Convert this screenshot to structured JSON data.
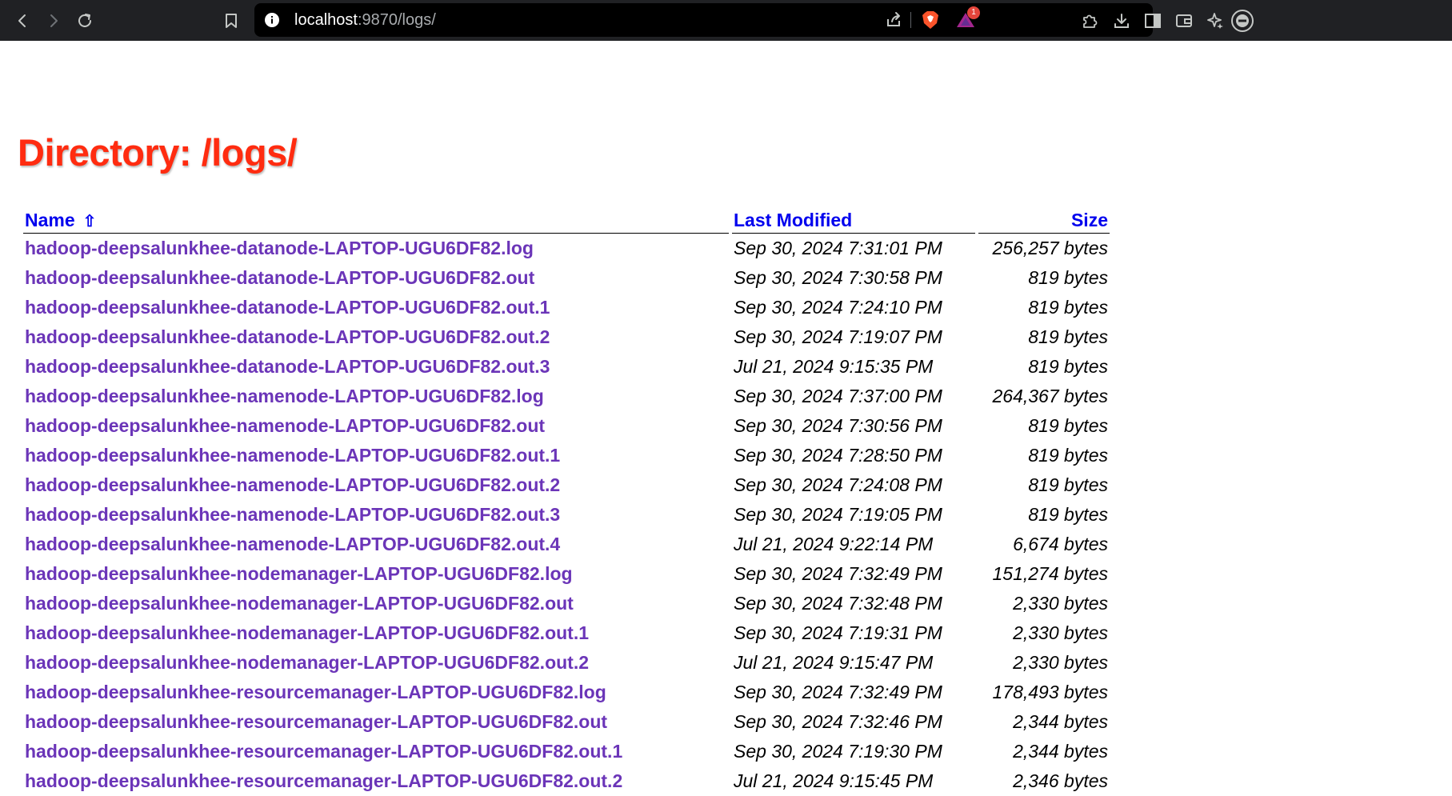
{
  "browser": {
    "url_host": "localhost",
    "url_rest": ":9870/logs/",
    "notification_count": "1",
    "icons": [
      "back-icon",
      "forward-icon",
      "reload-icon",
      "bookmark-icon",
      "site-info-icon",
      "share-icon",
      "brave-shield-icon",
      "brave-rewards-icon",
      "extensions-icon",
      "download-icon",
      "sidebar-icon",
      "wallet-icon",
      "leo-ai-icon",
      "profile-icon"
    ]
  },
  "page": {
    "title": "Directory: /logs/",
    "columns": {
      "name": "Name",
      "sort_indicator": "⇧",
      "modified": "Last Modified",
      "size": "Size"
    },
    "rows": [
      {
        "name": "hadoop-deepsalunkhee-datanode-LAPTOP-UGU6DF82.log",
        "modified": "Sep 30, 2024 7:31:01 PM",
        "size": "256,257 bytes"
      },
      {
        "name": "hadoop-deepsalunkhee-datanode-LAPTOP-UGU6DF82.out",
        "modified": "Sep 30, 2024 7:30:58 PM",
        "size": "819 bytes"
      },
      {
        "name": "hadoop-deepsalunkhee-datanode-LAPTOP-UGU6DF82.out.1",
        "modified": "Sep 30, 2024 7:24:10 PM",
        "size": "819 bytes"
      },
      {
        "name": "hadoop-deepsalunkhee-datanode-LAPTOP-UGU6DF82.out.2",
        "modified": "Sep 30, 2024 7:19:07 PM",
        "size": "819 bytes"
      },
      {
        "name": "hadoop-deepsalunkhee-datanode-LAPTOP-UGU6DF82.out.3",
        "modified": "Jul 21, 2024 9:15:35 PM",
        "size": "819 bytes"
      },
      {
        "name": "hadoop-deepsalunkhee-namenode-LAPTOP-UGU6DF82.log",
        "modified": "Sep 30, 2024 7:37:00 PM",
        "size": "264,367 bytes"
      },
      {
        "name": "hadoop-deepsalunkhee-namenode-LAPTOP-UGU6DF82.out",
        "modified": "Sep 30, 2024 7:30:56 PM",
        "size": "819 bytes"
      },
      {
        "name": "hadoop-deepsalunkhee-namenode-LAPTOP-UGU6DF82.out.1",
        "modified": "Sep 30, 2024 7:28:50 PM",
        "size": "819 bytes"
      },
      {
        "name": "hadoop-deepsalunkhee-namenode-LAPTOP-UGU6DF82.out.2",
        "modified": "Sep 30, 2024 7:24:08 PM",
        "size": "819 bytes"
      },
      {
        "name": "hadoop-deepsalunkhee-namenode-LAPTOP-UGU6DF82.out.3",
        "modified": "Sep 30, 2024 7:19:05 PM",
        "size": "819 bytes"
      },
      {
        "name": "hadoop-deepsalunkhee-namenode-LAPTOP-UGU6DF82.out.4",
        "modified": "Jul 21, 2024 9:22:14 PM",
        "size": "6,674 bytes"
      },
      {
        "name": "hadoop-deepsalunkhee-nodemanager-LAPTOP-UGU6DF82.log",
        "modified": "Sep 30, 2024 7:32:49 PM",
        "size": "151,274 bytes"
      },
      {
        "name": "hadoop-deepsalunkhee-nodemanager-LAPTOP-UGU6DF82.out",
        "modified": "Sep 30, 2024 7:32:48 PM",
        "size": "2,330 bytes"
      },
      {
        "name": "hadoop-deepsalunkhee-nodemanager-LAPTOP-UGU6DF82.out.1",
        "modified": "Sep 30, 2024 7:19:31 PM",
        "size": "2,330 bytes"
      },
      {
        "name": "hadoop-deepsalunkhee-nodemanager-LAPTOP-UGU6DF82.out.2",
        "modified": "Jul 21, 2024 9:15:47 PM",
        "size": "2,330 bytes"
      },
      {
        "name": "hadoop-deepsalunkhee-resourcemanager-LAPTOP-UGU6DF82.log",
        "modified": "Sep 30, 2024 7:32:49 PM",
        "size": "178,493 bytes"
      },
      {
        "name": "hadoop-deepsalunkhee-resourcemanager-LAPTOP-UGU6DF82.out",
        "modified": "Sep 30, 2024 7:32:46 PM",
        "size": "2,344 bytes"
      },
      {
        "name": "hadoop-deepsalunkhee-resourcemanager-LAPTOP-UGU6DF82.out.1",
        "modified": "Sep 30, 2024 7:19:30 PM",
        "size": "2,344 bytes"
      },
      {
        "name": "hadoop-deepsalunkhee-resourcemanager-LAPTOP-UGU6DF82.out.2",
        "modified": "Jul 21, 2024 9:15:45 PM",
        "size": "2,346 bytes"
      }
    ]
  },
  "colors": {
    "title": "#ff2c10",
    "link": "#6b35b8",
    "header_link": "#0000ee",
    "toolbar": "#202124"
  }
}
